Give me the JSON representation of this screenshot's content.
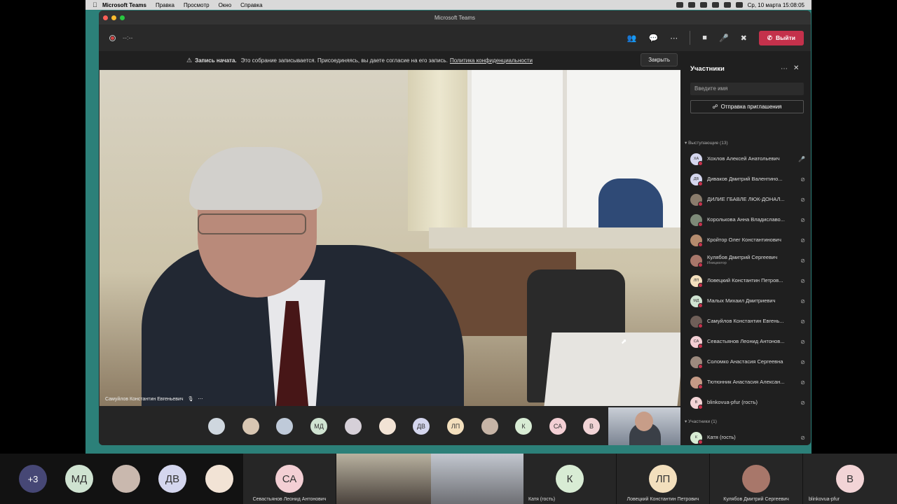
{
  "menubar": {
    "app": "Microsoft Teams",
    "items": [
      "Правка",
      "Просмотр",
      "Окно",
      "Справка"
    ],
    "datetime": "Ср, 10 марта  15:08:05"
  },
  "window": {
    "title": "Microsoft Teams"
  },
  "toolbar": {
    "timer": "--:--",
    "leave_label": "Выйти"
  },
  "banner": {
    "title": "Запись начата.",
    "text": "Это собрание записывается. Присоединяясь, вы даете согласие на его запись.",
    "link": "Политика конфиденциальности",
    "close": "Закрыть"
  },
  "video": {
    "name": "Самуйлов Константин Евгеньевич"
  },
  "strip": {
    "avatars": [
      {
        "initials": "",
        "color": "#cfd7df"
      },
      {
        "initials": "",
        "color": "#d8c6b2"
      },
      {
        "initials": "",
        "color": "#bfcad9"
      },
      {
        "initials": "МД",
        "color": "#cfe3d1"
      },
      {
        "initials": "",
        "color": "#d6d0d8"
      },
      {
        "initials": "",
        "color": "#f2e3d5"
      },
      {
        "initials": "ДВ",
        "color": "#d4d6ee"
      },
      {
        "initials": "ЛП",
        "color": "#f3dfbd"
      },
      {
        "initials": "",
        "color": "#c6b4a6"
      },
      {
        "initials": "К",
        "color": "#d8ecd4"
      },
      {
        "initials": "СА",
        "color": "#f3cfd4"
      },
      {
        "initials": "В",
        "color": "#f2d4d6"
      }
    ]
  },
  "panel": {
    "title": "Участники",
    "search_placeholder": "Введите имя",
    "invite": "Отправка приглашения",
    "presenters_label": "Выступающие (13)",
    "attendees_label": "Участники (1)",
    "presenters": [
      {
        "initials": "ХА",
        "name": "Хохлов Алексей Анатольевич",
        "sub": "",
        "color": "#d4d6ee",
        "mic": "on"
      },
      {
        "initials": "ДВ",
        "name": "Диваков Дмитрий Валентино...",
        "sub": "",
        "color": "#d4d6ee",
        "mic": "off"
      },
      {
        "initials": "",
        "name": "ДИЛИЕ ГБАВЛЕ ЛЮК-ДОНАЛ...",
        "sub": "",
        "color": "#8a7c6c",
        "mic": "off"
      },
      {
        "initials": "",
        "name": "Королькова Анна Владиславо...",
        "sub": "",
        "color": "#7d8a78",
        "mic": "off"
      },
      {
        "initials": "",
        "name": "Кройтор Олег Константинович",
        "sub": "",
        "color": "#b58c6e",
        "mic": "off"
      },
      {
        "initials": "",
        "name": "Кулябов Дмитрий Сергеевич",
        "sub": "Инициатор",
        "color": "#a8776a",
        "mic": "off"
      },
      {
        "initials": "ЛП",
        "name": "Ловецкий Константин Петров...",
        "sub": "",
        "color": "#f3dfbd",
        "mic": "off"
      },
      {
        "initials": "МД",
        "name": "Малых Михаил Дмитриевич",
        "sub": "",
        "color": "#cfe3d1",
        "mic": "off"
      },
      {
        "initials": "",
        "name": "Самуйлов Константин Евгень...",
        "sub": "",
        "color": "#6f5f58",
        "mic": "off"
      },
      {
        "initials": "СА",
        "name": "Севастьянов Леонид Антонов...",
        "sub": "",
        "color": "#f3cfd4",
        "mic": "off"
      },
      {
        "initials": "",
        "name": "Соломко Анастасия Сергеевна",
        "sub": "",
        "color": "#9c8a7e",
        "mic": "off"
      },
      {
        "initials": "",
        "name": "Тютюнник Анастасия Алексан...",
        "sub": "",
        "color": "#c49a86",
        "mic": "off"
      },
      {
        "initials": "B",
        "name": "blinkovua-pfur (гость)",
        "sub": "",
        "color": "#f2d4d6",
        "mic": "off"
      }
    ],
    "attendees": [
      {
        "initials": "К",
        "name": "Катя (гость)",
        "sub": "",
        "color": "#d8ecd4",
        "mic": "off"
      }
    ]
  },
  "gallery": {
    "more": "+3",
    "items": [
      {
        "initials": "МД",
        "label": ""
      },
      {
        "initials": "",
        "label": ""
      },
      {
        "initials": "ДВ",
        "label": ""
      },
      {
        "initials": "",
        "label": ""
      }
    ],
    "tiles": [
      {
        "initials": "СА",
        "label": "Севастьянов Леонид Антонович"
      },
      {
        "initials": "",
        "label": ""
      },
      {
        "initials": "",
        "label": "Катя (гость)"
      },
      {
        "initials": "К",
        "label": ""
      },
      {
        "initials": "ЛП",
        "label": "Ловецкий Константин Петрович"
      },
      {
        "initials": "",
        "label": "Кулябов Дмитрий Сергеевич"
      },
      {
        "initials": "В",
        "label": "blinkovua-pfur"
      }
    ]
  }
}
